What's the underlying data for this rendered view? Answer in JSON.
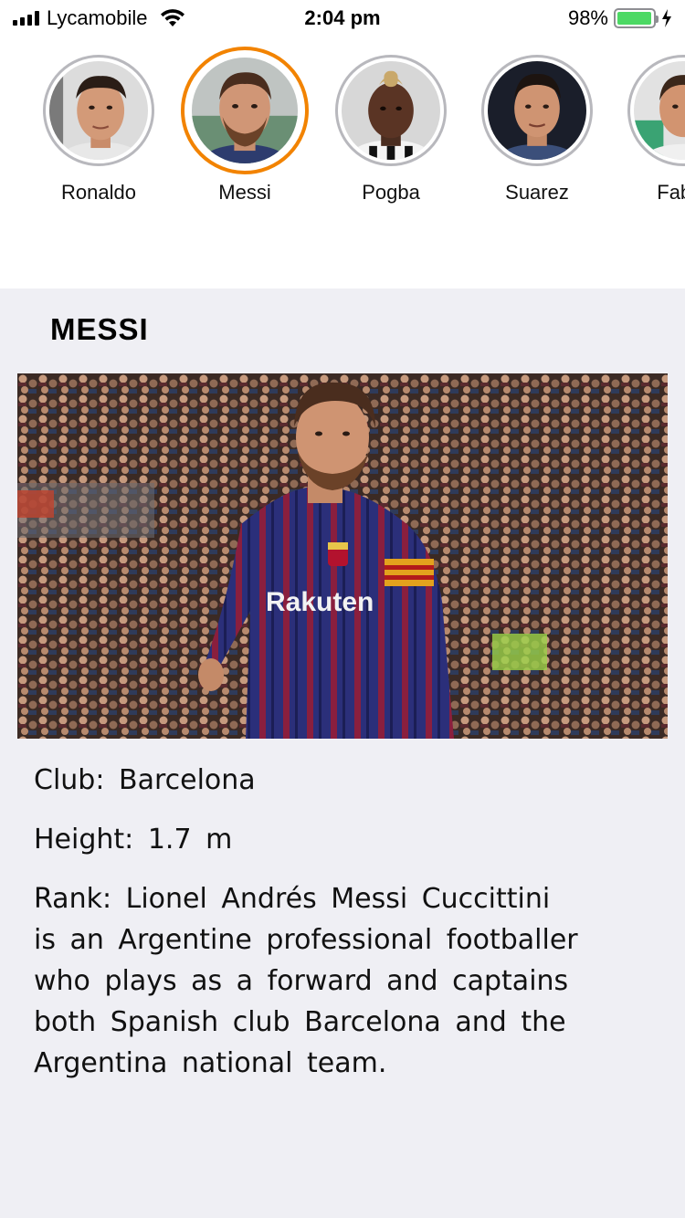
{
  "status_bar": {
    "carrier": "Lycamobile",
    "time": "2:04 pm",
    "battery_percent": "98%",
    "battery_level": 0.98,
    "icons": [
      "signal-icon",
      "wifi-icon",
      "battery-icon",
      "charging-bolt-icon"
    ]
  },
  "players": [
    {
      "name": "Ronaldo",
      "selected": false
    },
    {
      "name": "Messi",
      "selected": true
    },
    {
      "name": "Pogba",
      "selected": false
    },
    {
      "name": "Suarez",
      "selected": false
    },
    {
      "name": "Fabre",
      "selected": false
    }
  ],
  "detail": {
    "title": "MESSI",
    "club_label": "Club:",
    "club_value": "Barcelona",
    "height_label": "Height:",
    "height_value": "1.7 m",
    "rank_label": "Rank:",
    "rank_value": "Lionel Andrés Messi Cuccittini is an Argentine professional footballer who plays as a forward and captains both Spanish club Barcelona and the Argentina national team."
  },
  "colors": {
    "selected_ring": "#f28300",
    "panel_background": "#efeff4",
    "battery_fill": "#4cd964"
  }
}
